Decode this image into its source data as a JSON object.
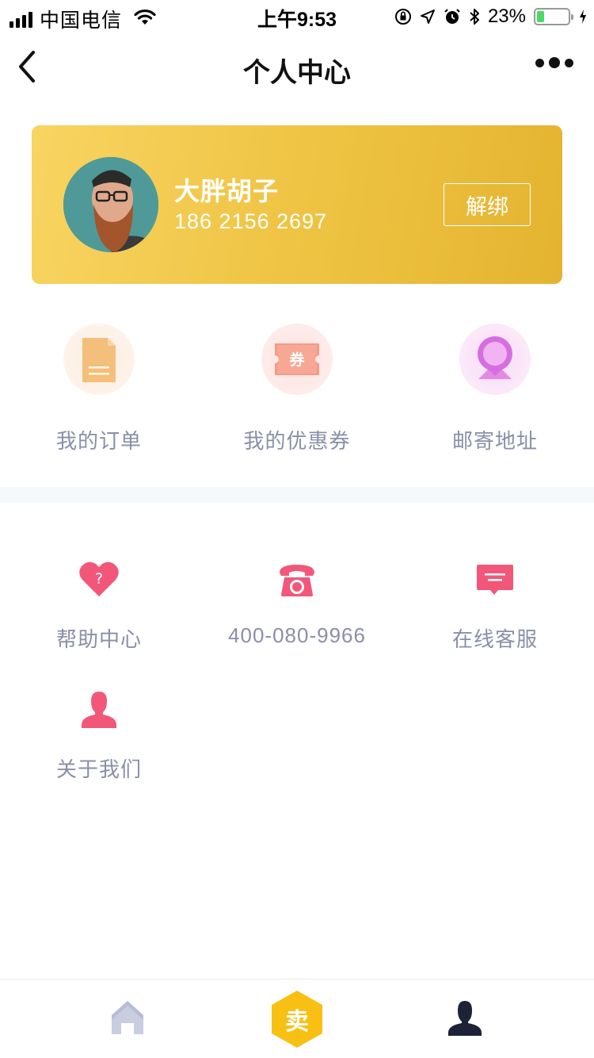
{
  "status_bar": {
    "carrier": "中国电信",
    "time": "上午9:53",
    "battery_percent": "23%",
    "battery_level": 0.23
  },
  "nav": {
    "title": "个人中心"
  },
  "profile": {
    "name": "大胖胡子",
    "phone": "186 2156 2697",
    "unbind_label": "解绑"
  },
  "quick_actions": [
    {
      "label": "我的订单",
      "icon": "order-document-icon"
    },
    {
      "label": "我的优惠券",
      "icon": "coupon-icon",
      "icon_text": "券"
    },
    {
      "label": "邮寄地址",
      "icon": "location-pin-icon"
    }
  ],
  "services": [
    {
      "label": "帮助中心",
      "icon": "help-heart-icon"
    },
    {
      "label": "400-080-9966",
      "icon": "telephone-icon"
    },
    {
      "label": "在线客服",
      "icon": "chat-bubble-icon"
    },
    {
      "label": "关于我们",
      "icon": "person-icon"
    }
  ],
  "tab_bar": {
    "sell_label": "卖",
    "tabs": [
      "home-icon",
      "sell-icon",
      "profile-icon"
    ]
  },
  "colors": {
    "card_gradient_start": "#f8d461",
    "card_gradient_end": "#e4b430",
    "service_pink": "#f2577a",
    "label_gray": "#8a8fa8",
    "sell_yellow": "#f8c012"
  }
}
